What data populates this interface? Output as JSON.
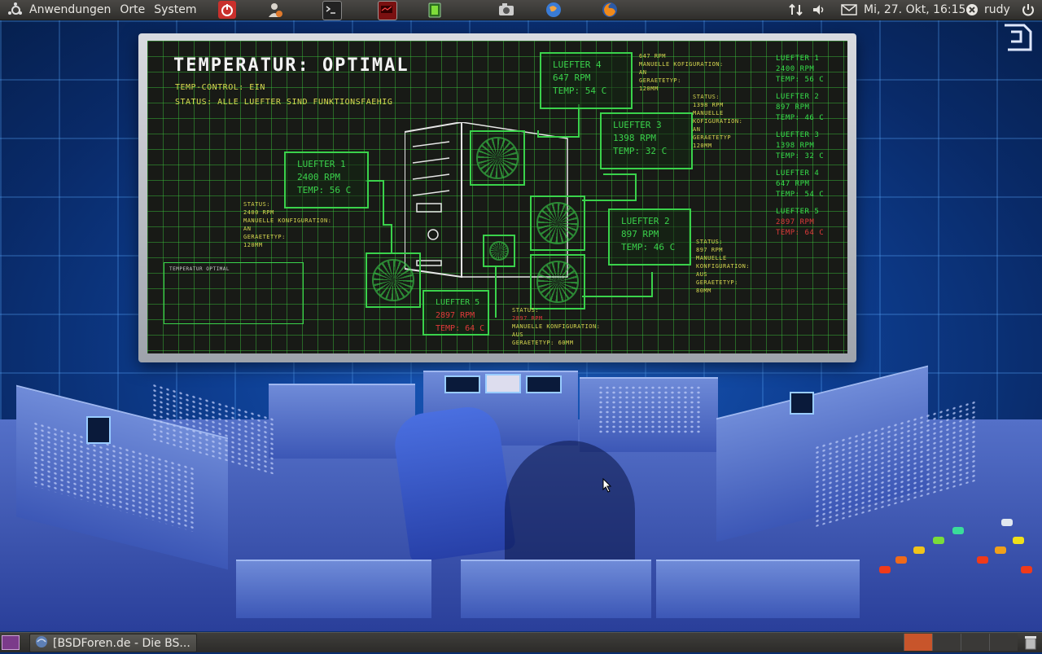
{
  "top_panel": {
    "menu": [
      "Anwendungen",
      "Orte",
      "System"
    ],
    "launchers": [
      "power-app-icon",
      "user-app-icon",
      "terminal-icon",
      "monitor-app-icon",
      "battery-app-icon",
      "screenshot-icon",
      "browser-globe-icon",
      "firefox-icon"
    ],
    "clock": "Mi, 27. Okt, 16:15",
    "user": "rudy"
  },
  "wallpaper": {
    "title": "TEMPERATUR: OPTIMAL",
    "temp_control": "TEMP-CONTROL: EIN",
    "status_line": "STATUS: ALLE LUEFTER SIND FUNKTIONSFAEHIG",
    "fans": [
      {
        "name": "LUEFTER 1",
        "rpm": "2400 RPM",
        "temp": "TEMP: 56 C"
      },
      {
        "name": "LUEFTER 2",
        "rpm": "897 RPM",
        "temp": "TEMP: 46 C"
      },
      {
        "name": "LUEFTER 3",
        "rpm": "1398 RPM",
        "temp": "TEMP: 32 C"
      },
      {
        "name": "LUEFTER 4",
        "rpm": "647 RPM",
        "temp": "TEMP: 54 C"
      },
      {
        "name": "LUEFTER 5",
        "rpm": "2897 RPM",
        "temp": "TEMP: 64 C"
      }
    ],
    "status_blocks": {
      "fan1": [
        "STATUS:",
        "2400 RPM",
        "MANUELLE KONFIGURATION:",
        "AN",
        "GERAETETYP:",
        "120MM"
      ],
      "fan2": [
        "STATUS:",
        "897 RPM",
        "MANUELLE",
        "KONFIGURATION:",
        "AUS",
        "GERAETETYP:",
        "80MM"
      ],
      "fan3": [
        "STATUS:",
        "1398 RPM",
        "MANUELLE",
        "KOFIGURATION:",
        "AN",
        "GERAETETYP",
        "120MM"
      ],
      "fan4": [
        "647 RPM",
        "MANUELLE KOFIGURATION:",
        "AN",
        "GERAETETYP:",
        "120MM"
      ],
      "fan5": [
        "STATUS:",
        "2897 RPM",
        "MANUELLE KONFIGURATION:",
        "AUS",
        "GERAETETYP: 60MM"
      ]
    },
    "thumbnail_title": "TEMPERATUR OPTIMAL"
  },
  "bottom_panel": {
    "task_title": "[BSDForen.de - Die BS..."
  },
  "colors": {
    "panel": "#3a3936",
    "grid_green": "#3ad24b",
    "alert_red": "#e03a3a",
    "workspace_active": "#c8552b"
  }
}
